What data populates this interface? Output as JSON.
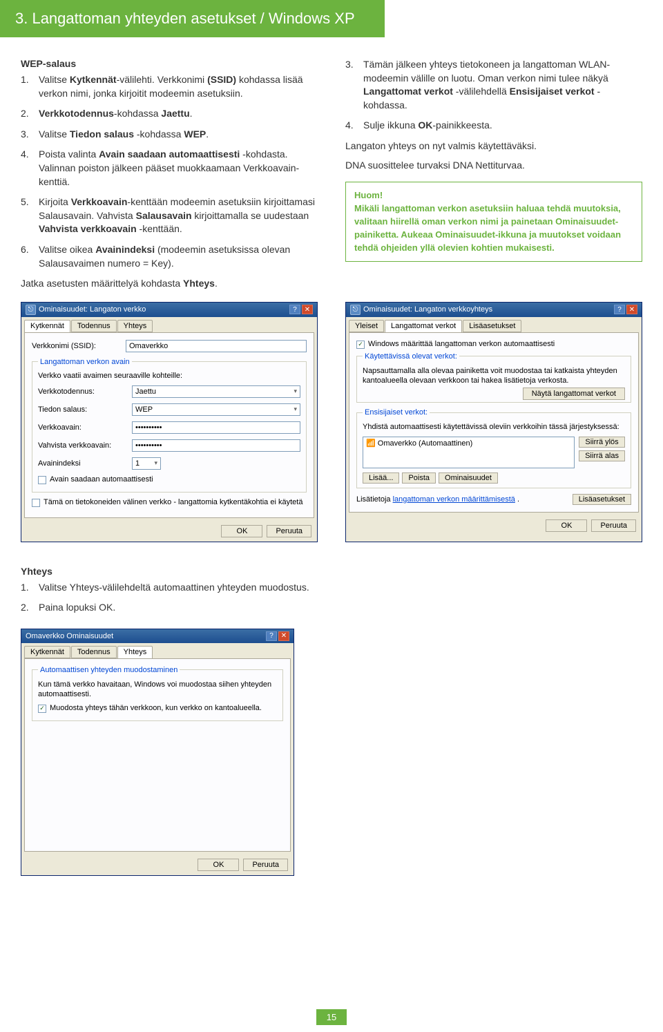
{
  "header": "3. Langattoman yhteyden asetukset / Windows XP",
  "left": {
    "title": "WEP-salaus",
    "items": [
      "Valitse <b>Kytkennät</b>-välilehti. Verkkonimi <b>(SSID)</b> kohdassa lisää verkon nimi, jonka kirjoitit modeemin asetuksiin.",
      "<b>Verkkotodennus</b>-kohdassa <b>Jaettu</b>.",
      "Valitse <b>Tiedon salaus</b> -kohdassa <b>WEP</b>.",
      "Poista valinta <b>Avain saadaan automaattisesti</b> -kohdasta. Valinnan poiston jälkeen pääset muokkaamaan Verkkoavain-kenttiä.",
      "Kirjoita <b>Verkkoavain</b>-kenttään modeemin asetuksiin kirjoittamasi Salausavain. Vahvista <b>Salausavain</b> kirjoittamalla se uudestaan <b>Vahvista verkkoavain</b> -kenttään.",
      "Valitse oikea <b>Avainindeksi</b> (modeemin asetuksissa olevan Salausavaimen numero = Key)."
    ],
    "continue": "Jatka asetusten määrittelyä kohdasta <b>Yhteys</b>."
  },
  "right": {
    "items": [
      {
        "n": "3.",
        "t": "Tämän jälkeen yhteys tietokoneen ja langattoman WLAN-modeemin välille on luotu. Oman verkon nimi tulee näkyä <b>Langattomat verkot</b> -välilehdellä <b>Ensisijaiset verkot</b> -kohdassa."
      },
      {
        "n": "4.",
        "t": "Sulje ikkuna <b>OK</b>-painikkeesta."
      }
    ],
    "p1": "Langaton yhteys on nyt valmis käytettäväksi.",
    "p2": "DNA suosittelee turvaksi DNA Nettiturvaa.",
    "note": "<b>Huom!</b><br><b>Mikäli langattoman verkon asetuksiin haluaa tehdä muutoksia, valitaan hiirellä oman verkon nimi ja painetaan Ominaisuudet-painiketta. Aukeaa Ominaisuudet-ikkuna ja muutokset voidaan tehdä ohjeiden yllä olevien kohtien mukaisesti.</b>"
  },
  "dialog1": {
    "title": "Ominaisuudet: Langaton verkko",
    "tabs": [
      "Kytkennät",
      "Todennus",
      "Yhteys"
    ],
    "ssidLabel": "Verkkonimi (SSID):",
    "ssidVal": "Omaverkko",
    "grp": "Langattoman verkon avain",
    "grpLine": "Verkko vaatii avaimen seuraaville kohteille:",
    "authLabel": "Verkkotodennus:",
    "authVal": "Jaettu",
    "encLabel": "Tiedon salaus:",
    "encVal": "WEP",
    "keyLabel": "Verkkoavain:",
    "keyVal": "••••••••••",
    "key2Label": "Vahvista verkkoavain:",
    "key2Val": "••••••••••",
    "idxLabel": "Avainindeksi",
    "idxVal": "1",
    "autoKey": "Avain saadaan automaattisesti",
    "adhoc": "Tämä on tietokoneiden välinen verkko - langattomia kytkentäkohtia ei käytetä",
    "ok": "OK",
    "cancel": "Peruuta"
  },
  "dialog2": {
    "title": "Ominaisuudet: Langaton verkkoyhteys",
    "tabs": [
      "Yleiset",
      "Langattomat verkot",
      "Lisäasetukset"
    ],
    "autoCfg": "Windows määrittää langattoman verkon automaattisesti",
    "availGroup": "Käytettävissä olevat verkot:",
    "availHelp": "Napsauttamalla alla olevaa painiketta voit muodostaa tai katkaista yhteyden kantoalueella olevaan verkkoon tai hakea lisätietoja verkosta.",
    "showBtn": "Näytä langattomat verkot",
    "prefGroup": "Ensisijaiset verkot:",
    "prefHelp": "Yhdistä automaattisesti käytettävissä oleviin verkkoihin tässä järjestyksessä:",
    "net": "Omaverkko (Automaattinen)",
    "moveUp": "Siirrä ylös",
    "moveDown": "Siirrä alas",
    "add": "Lisää...",
    "remove": "Poista",
    "props": "Ominaisuudet",
    "moreLabel": "Lisätietoja ",
    "moreLink": "langattoman verkon määrittämisestä",
    "moreBtn": "Lisäasetukset",
    "ok": "OK",
    "cancel": "Peruuta"
  },
  "bottom": {
    "title": "Yhteys",
    "items": [
      "Valitse Yhteys-välilehdeltä automaattinen yhteyden muodostus.",
      "Paina lopuksi OK."
    ]
  },
  "dialog3": {
    "title": "Omaverkko Ominaisuudet",
    "tabs": [
      "Kytkennät",
      "Todennus",
      "Yhteys"
    ],
    "group": "Automaattisen yhteyden muodostaminen",
    "help": "Kun tämä verkko havaitaan, Windows voi muodostaa siihen yhteyden automaattisesti.",
    "chk": "Muodosta yhteys tähän verkkoon, kun verkko on kantoalueella.",
    "ok": "OK",
    "cancel": "Peruuta"
  },
  "page": "15"
}
